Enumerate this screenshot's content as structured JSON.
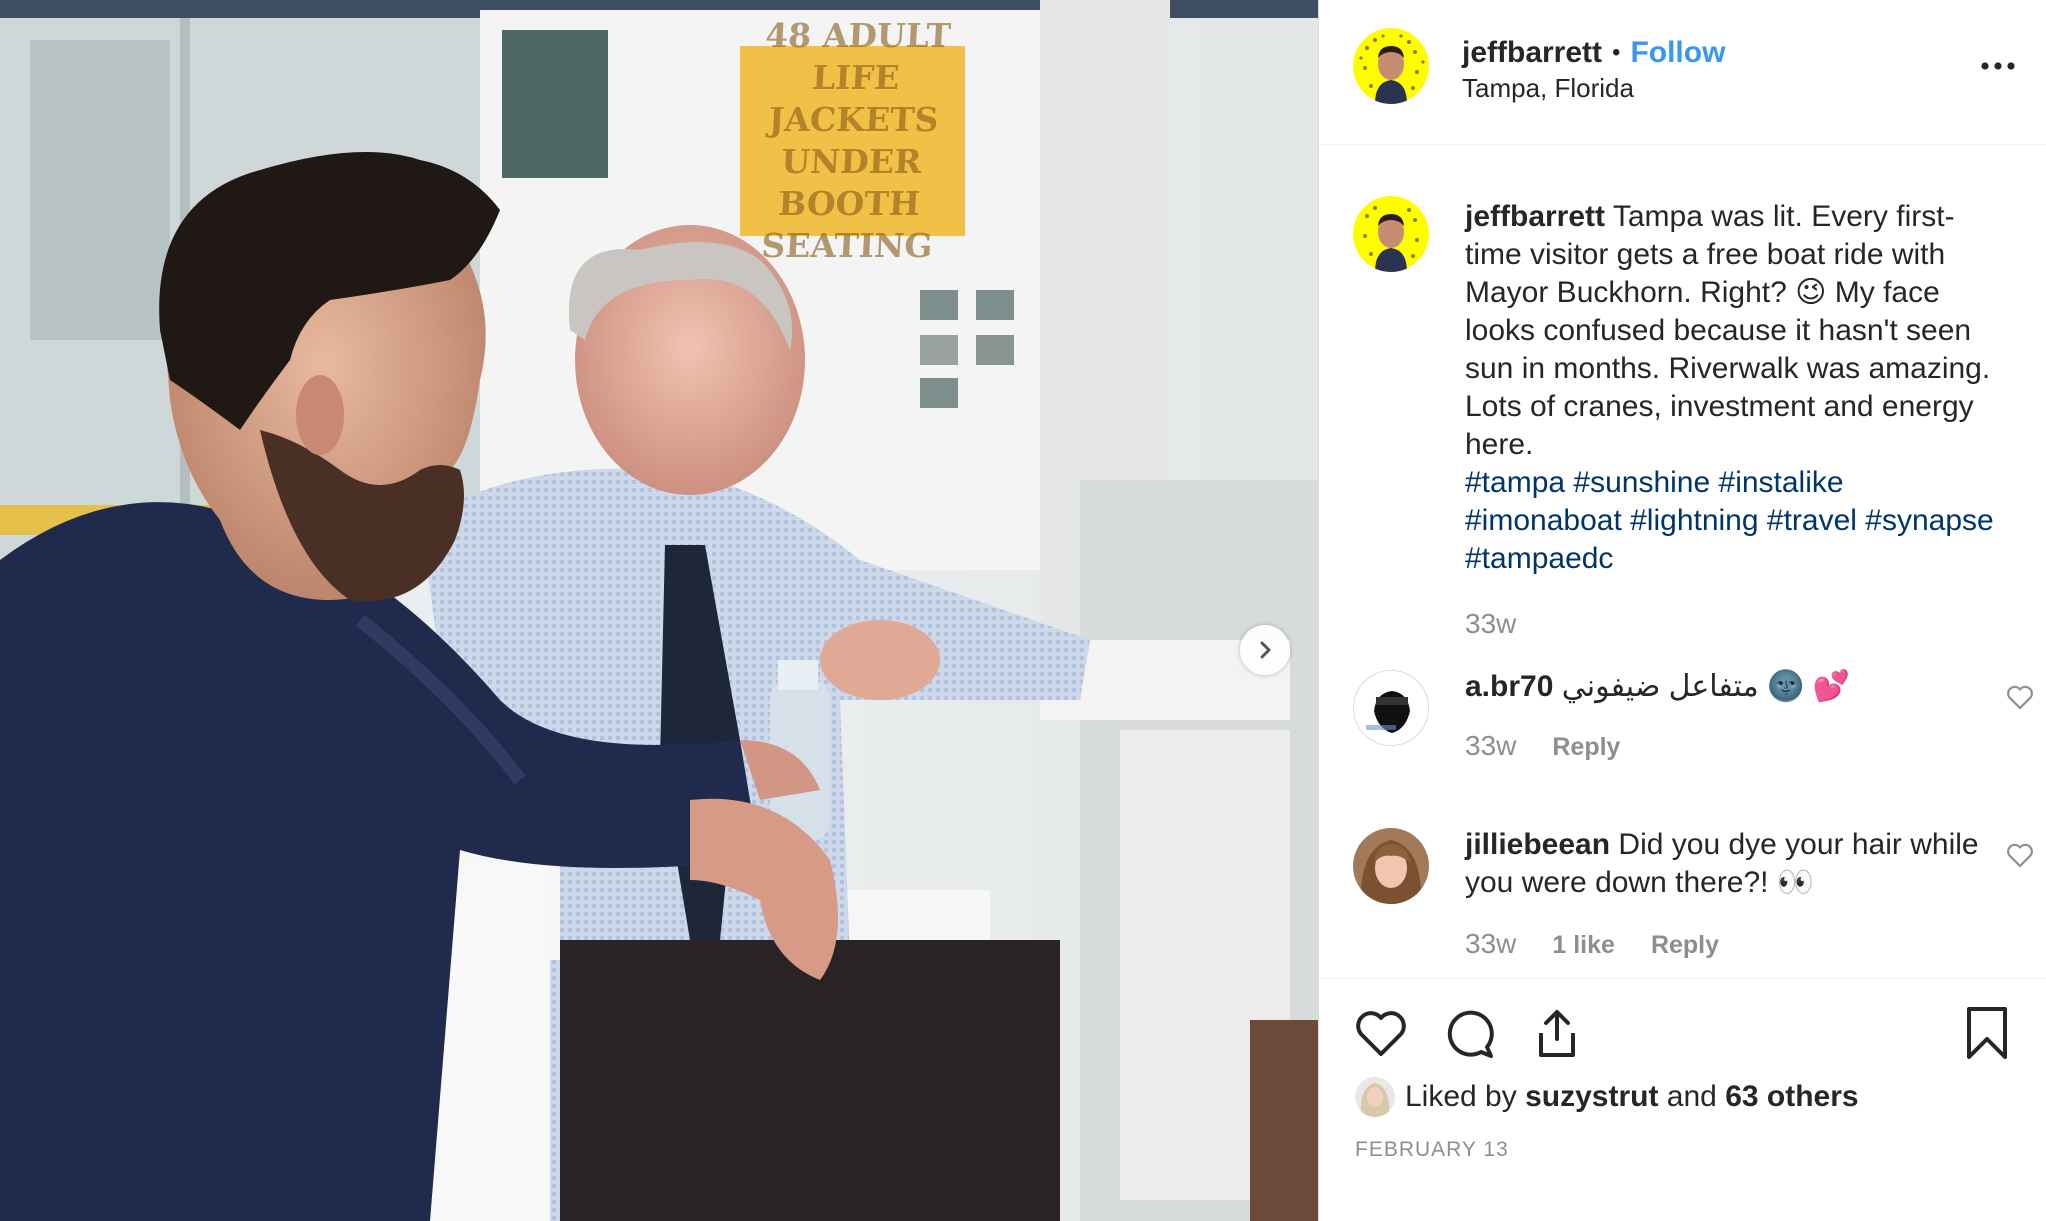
{
  "post_header": {
    "username": "jeffbarrett",
    "separator": "•",
    "follow_label": "Follow",
    "location": "Tampa, Florida"
  },
  "photo": {
    "sign_text": "48 ADULT LIFE JACKETS UNDER BOOTH SEATING"
  },
  "caption": {
    "username": "jeffbarrett",
    "text": "Tampa was lit. Every first-time visitor gets a free boat ride with Mayor Buckhorn. Right? 😉  My face looks confused because it hasn't seen sun in months. Riverwalk was amazing. Lots of cranes, investment and energy here.",
    "hashtags": "#tampa #sunshine #instalike #imonaboat #lightning #travel #synapse #tampaedc",
    "time": "33w"
  },
  "comments": [
    {
      "username": "a.br70",
      "text": "متفاعل ضيفوني 🌚 💕",
      "time": "33w",
      "likes": "",
      "reply_label": "Reply"
    },
    {
      "username": "jilliebeean",
      "text": "Did you dye your hair while you were down there?! 👀",
      "time": "33w",
      "likes": "1 like",
      "reply_label": "Reply"
    }
  ],
  "likes": {
    "prefix": "Liked by",
    "user": "suzystrut",
    "conjunction": "and",
    "others": "63 others"
  },
  "date": "FEBRUARY 13",
  "icons": {
    "like": "heart-icon",
    "comment": "comment-icon",
    "share": "share-icon",
    "save": "bookmark-icon",
    "more": "more-options-icon",
    "next": "chevron-right-icon"
  },
  "colors": {
    "link_blue": "#3897f0",
    "hashtag": "#003569",
    "muted": "#8e8e8e",
    "text": "#262626",
    "avatar_yellow": "#fffc00"
  }
}
